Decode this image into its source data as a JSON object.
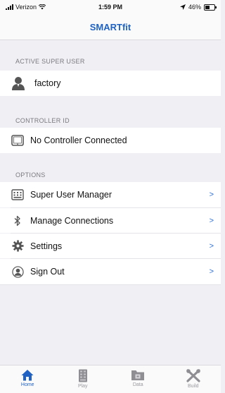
{
  "status_bar": {
    "carrier": "Verizon",
    "time": "1:59 PM",
    "battery": "46%"
  },
  "header": {
    "title": "SMARTfit"
  },
  "sections": {
    "active_super_user": {
      "header": "ACTIVE SUPER USER",
      "user": "factory",
      "icon": "person-icon"
    },
    "controller_id": {
      "header": "CONTROLLER ID",
      "status": "No Controller Connected",
      "icon": "tablet-icon"
    },
    "options": {
      "header": "OPTIONS",
      "items": [
        {
          "label": "Super User Manager",
          "icon": "keypad-icon"
        },
        {
          "label": "Manage Connections",
          "icon": "bluetooth-icon"
        },
        {
          "label": "Settings",
          "icon": "gear-icon"
        },
        {
          "label": "Sign Out",
          "icon": "person-circle-icon"
        }
      ],
      "chevron": ">"
    }
  },
  "tabbar": {
    "tabs": [
      {
        "label": "Home",
        "icon": "home-icon",
        "active": true
      },
      {
        "label": "Play",
        "icon": "play-icon",
        "active": false
      },
      {
        "label": "Data",
        "icon": "folder-icon",
        "active": false
      },
      {
        "label": "Build",
        "icon": "tools-icon",
        "active": false
      }
    ]
  },
  "colors": {
    "accent": "#1f62c4",
    "chevron": "#2a6fd6",
    "background": "#efeff4"
  }
}
